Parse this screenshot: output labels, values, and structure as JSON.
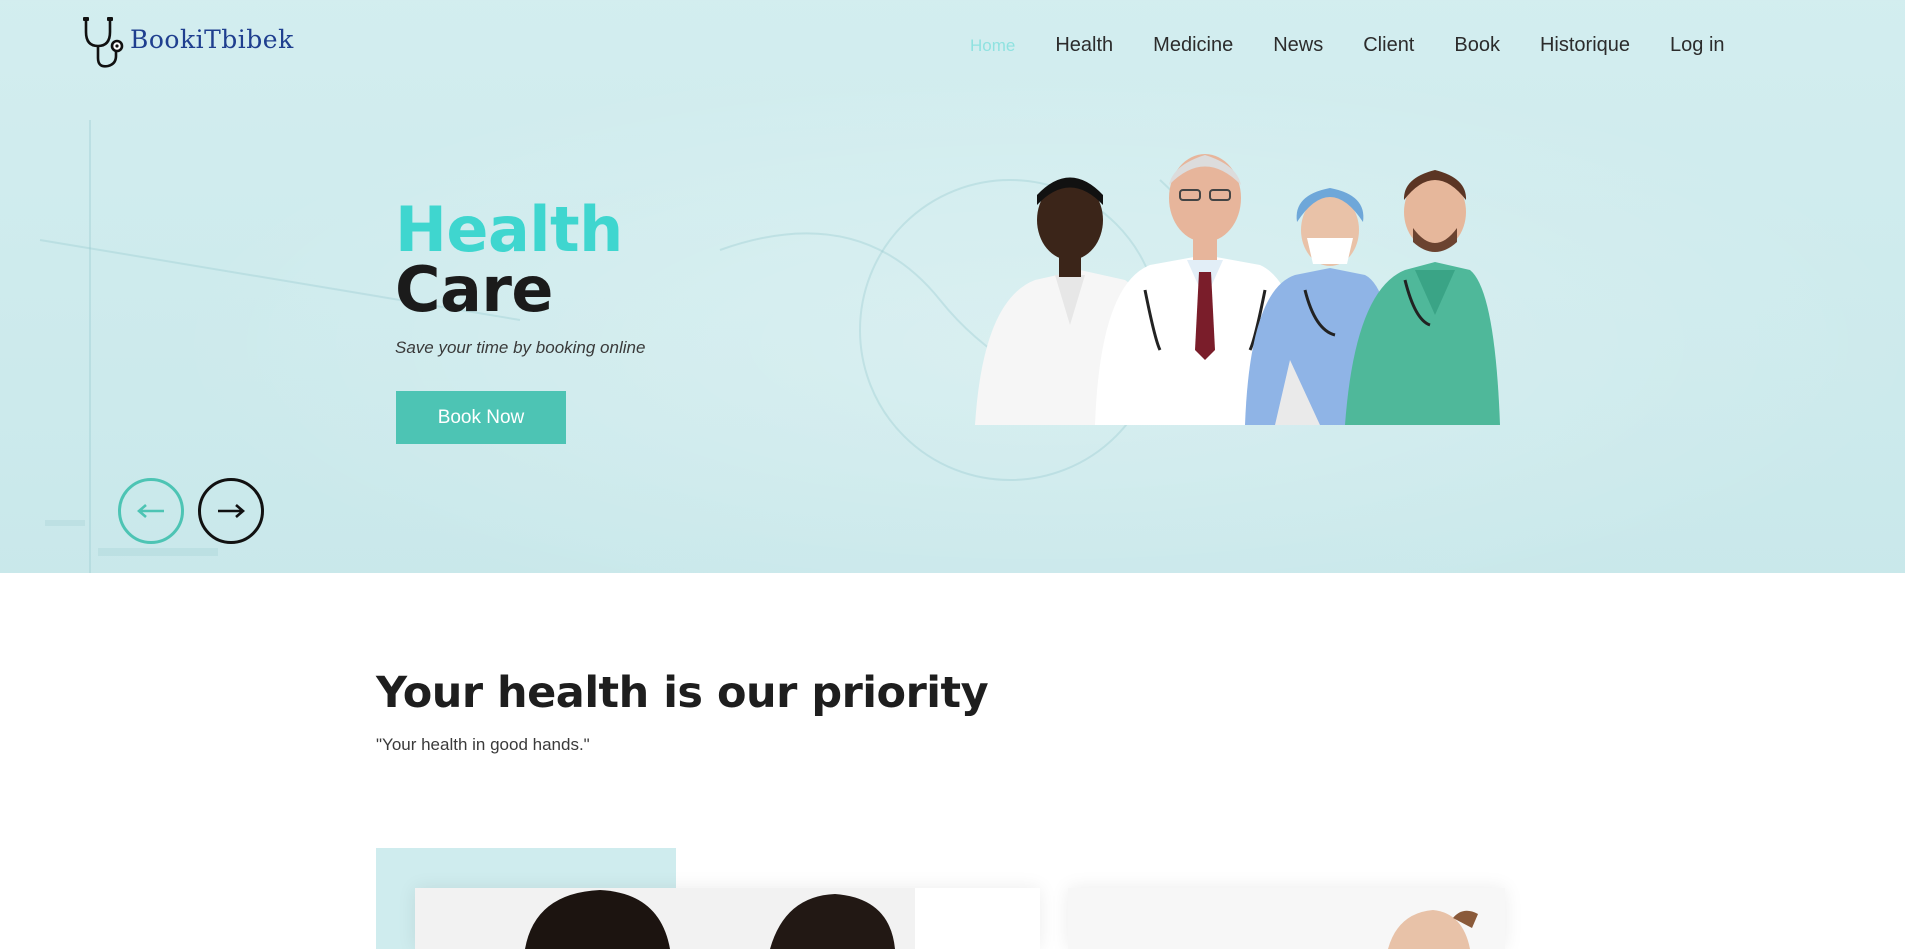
{
  "logo": {
    "text": "BookiTbibek",
    "icon": "stethoscope-icon"
  },
  "nav": {
    "items": [
      {
        "label": "Home",
        "active": true
      },
      {
        "label": "Health",
        "active": false
      },
      {
        "label": "Medicine",
        "active": false
      },
      {
        "label": "News",
        "active": false
      },
      {
        "label": "Client",
        "active": false
      },
      {
        "label": "Book",
        "active": false
      },
      {
        "label": "Historique",
        "active": false
      },
      {
        "label": "Log in",
        "active": false
      }
    ]
  },
  "hero": {
    "title_line1": "Health",
    "title_line2": "Care",
    "subtitle": "Save your time by booking online",
    "cta_label": "Book Now",
    "prev_icon": "arrow-left-icon",
    "next_icon": "arrow-right-icon",
    "image": "doctors-group-photo"
  },
  "section": {
    "title": "Your health is our priority",
    "quote": "\"Your health in good hands.\""
  },
  "colors": {
    "accent": "#3fd6cf",
    "button": "#4dc4b4",
    "hero_bg": "#cfecee",
    "logo_text": "#1f3f8f",
    "dark_text": "#1b1b1b"
  }
}
